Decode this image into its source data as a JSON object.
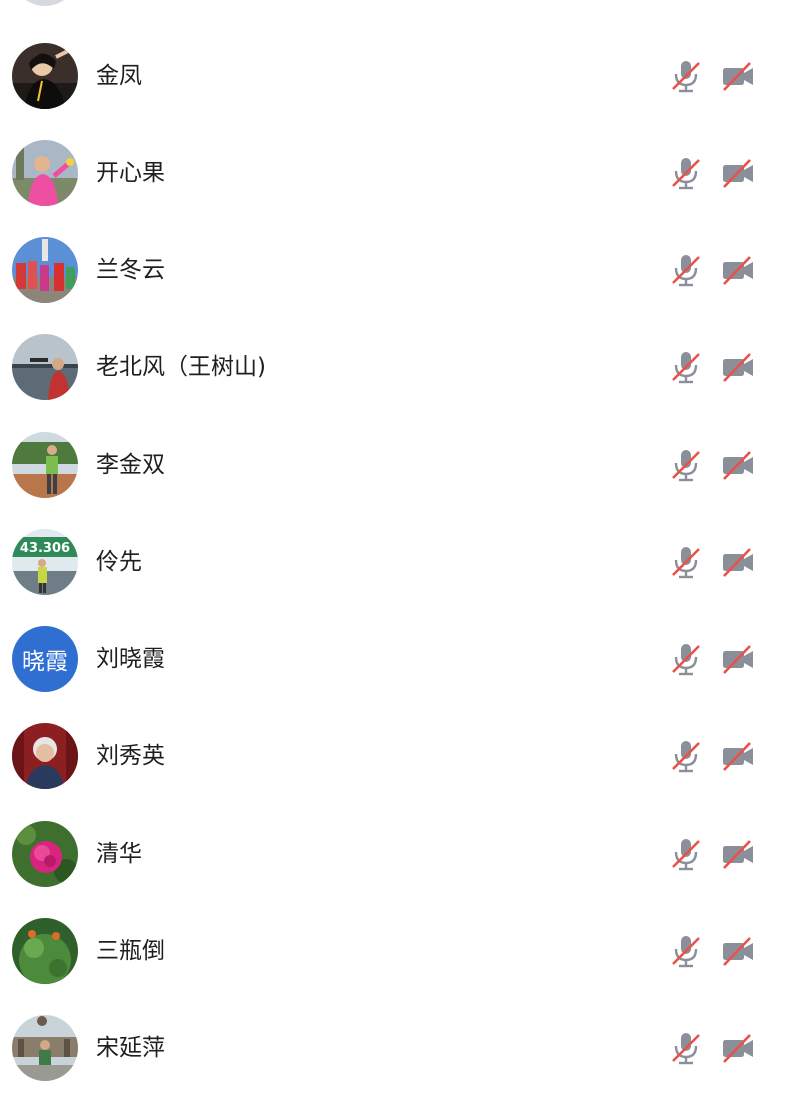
{
  "participants": [
    {
      "name": "金凤",
      "avatar_initials": ""
    },
    {
      "name": "开心果",
      "avatar_initials": ""
    },
    {
      "name": "兰冬云",
      "avatar_initials": ""
    },
    {
      "name": "老北风（王树山)",
      "avatar_initials": ""
    },
    {
      "name": "李金双",
      "avatar_initials": ""
    },
    {
      "name": "伶先",
      "avatar_initials": "",
      "photo_banner_text": "43.306"
    },
    {
      "name": "刘晓霞",
      "avatar_initials": "晓霞"
    },
    {
      "name": "刘秀英",
      "avatar_initials": ""
    },
    {
      "name": "清华",
      "avatar_initials": ""
    },
    {
      "name": "三瓶倒",
      "avatar_initials": ""
    },
    {
      "name": "宋延萍",
      "avatar_initials": ""
    }
  ],
  "status_icons": {
    "microphone": "microphone-muted-icon",
    "camera": "camera-off-icon"
  },
  "colors": {
    "name_text": "#1f1f1f",
    "icon_gray": "#8a8f99",
    "slash_red": "#e8524a",
    "initials_avatar_bg": "#2f6fd1"
  }
}
